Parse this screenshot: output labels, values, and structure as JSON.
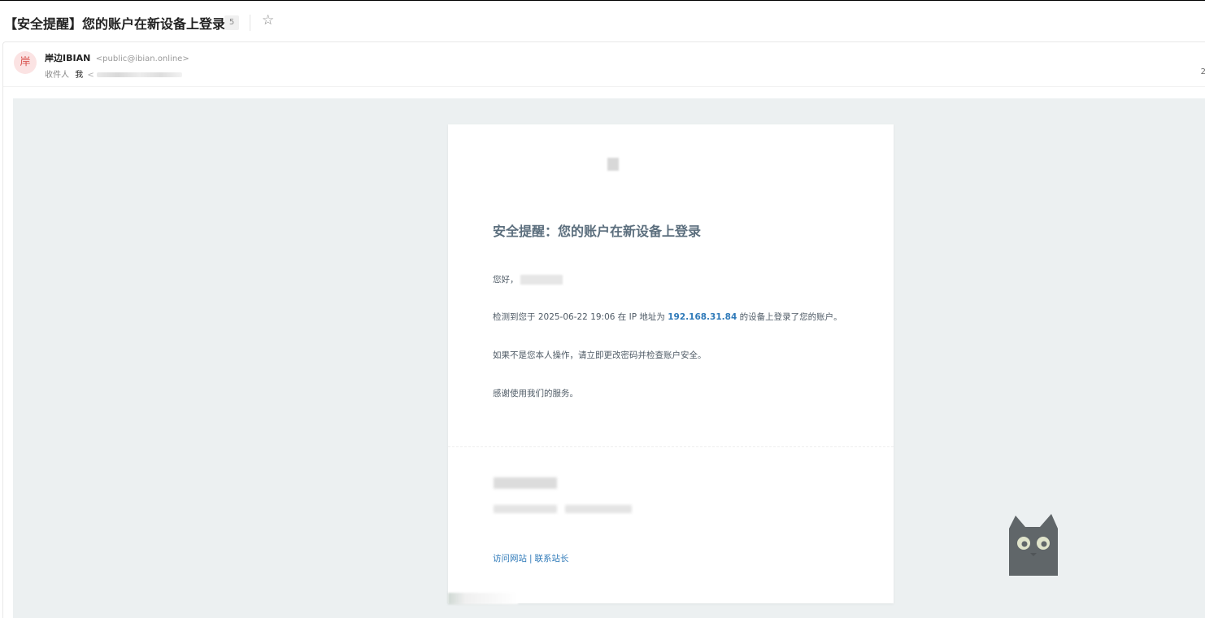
{
  "subject": {
    "title": "【安全提醒】您的账户在新设备上登录",
    "count": "5",
    "star_icon": "star-outline-icon"
  },
  "header": {
    "avatar_char": "岸",
    "sender_name": "岸边IBIAN",
    "sender_email": "<public@ibian.online>",
    "recipient_label": "收件人",
    "recipient_me": "我",
    "recipient_email_prefix": "<",
    "date_peek": "2"
  },
  "email": {
    "title": "安全提醒：您的账户在新设备上登录",
    "greeting": "您好，",
    "detect_prefix": "检测到您于 2025-06-22 19:06 在 IP 地址为 ",
    "ip": "192.168.31.84",
    "detect_suffix": " 的设备上登录了您的账户。",
    "warning": "如果不是您本人操作，请立即更改密码并检查账户安全。",
    "thanks": "感谢使用我们的服务。",
    "link_visit": "访问网站",
    "link_sep": "|",
    "link_contact": "联系站长"
  },
  "colors": {
    "content_bg": "#ecf0f1",
    "link": "#2f7ab9",
    "title": "#5b6e7d",
    "avatar_bg": "#fbe3e3",
    "avatar_fg": "#d9534f"
  }
}
